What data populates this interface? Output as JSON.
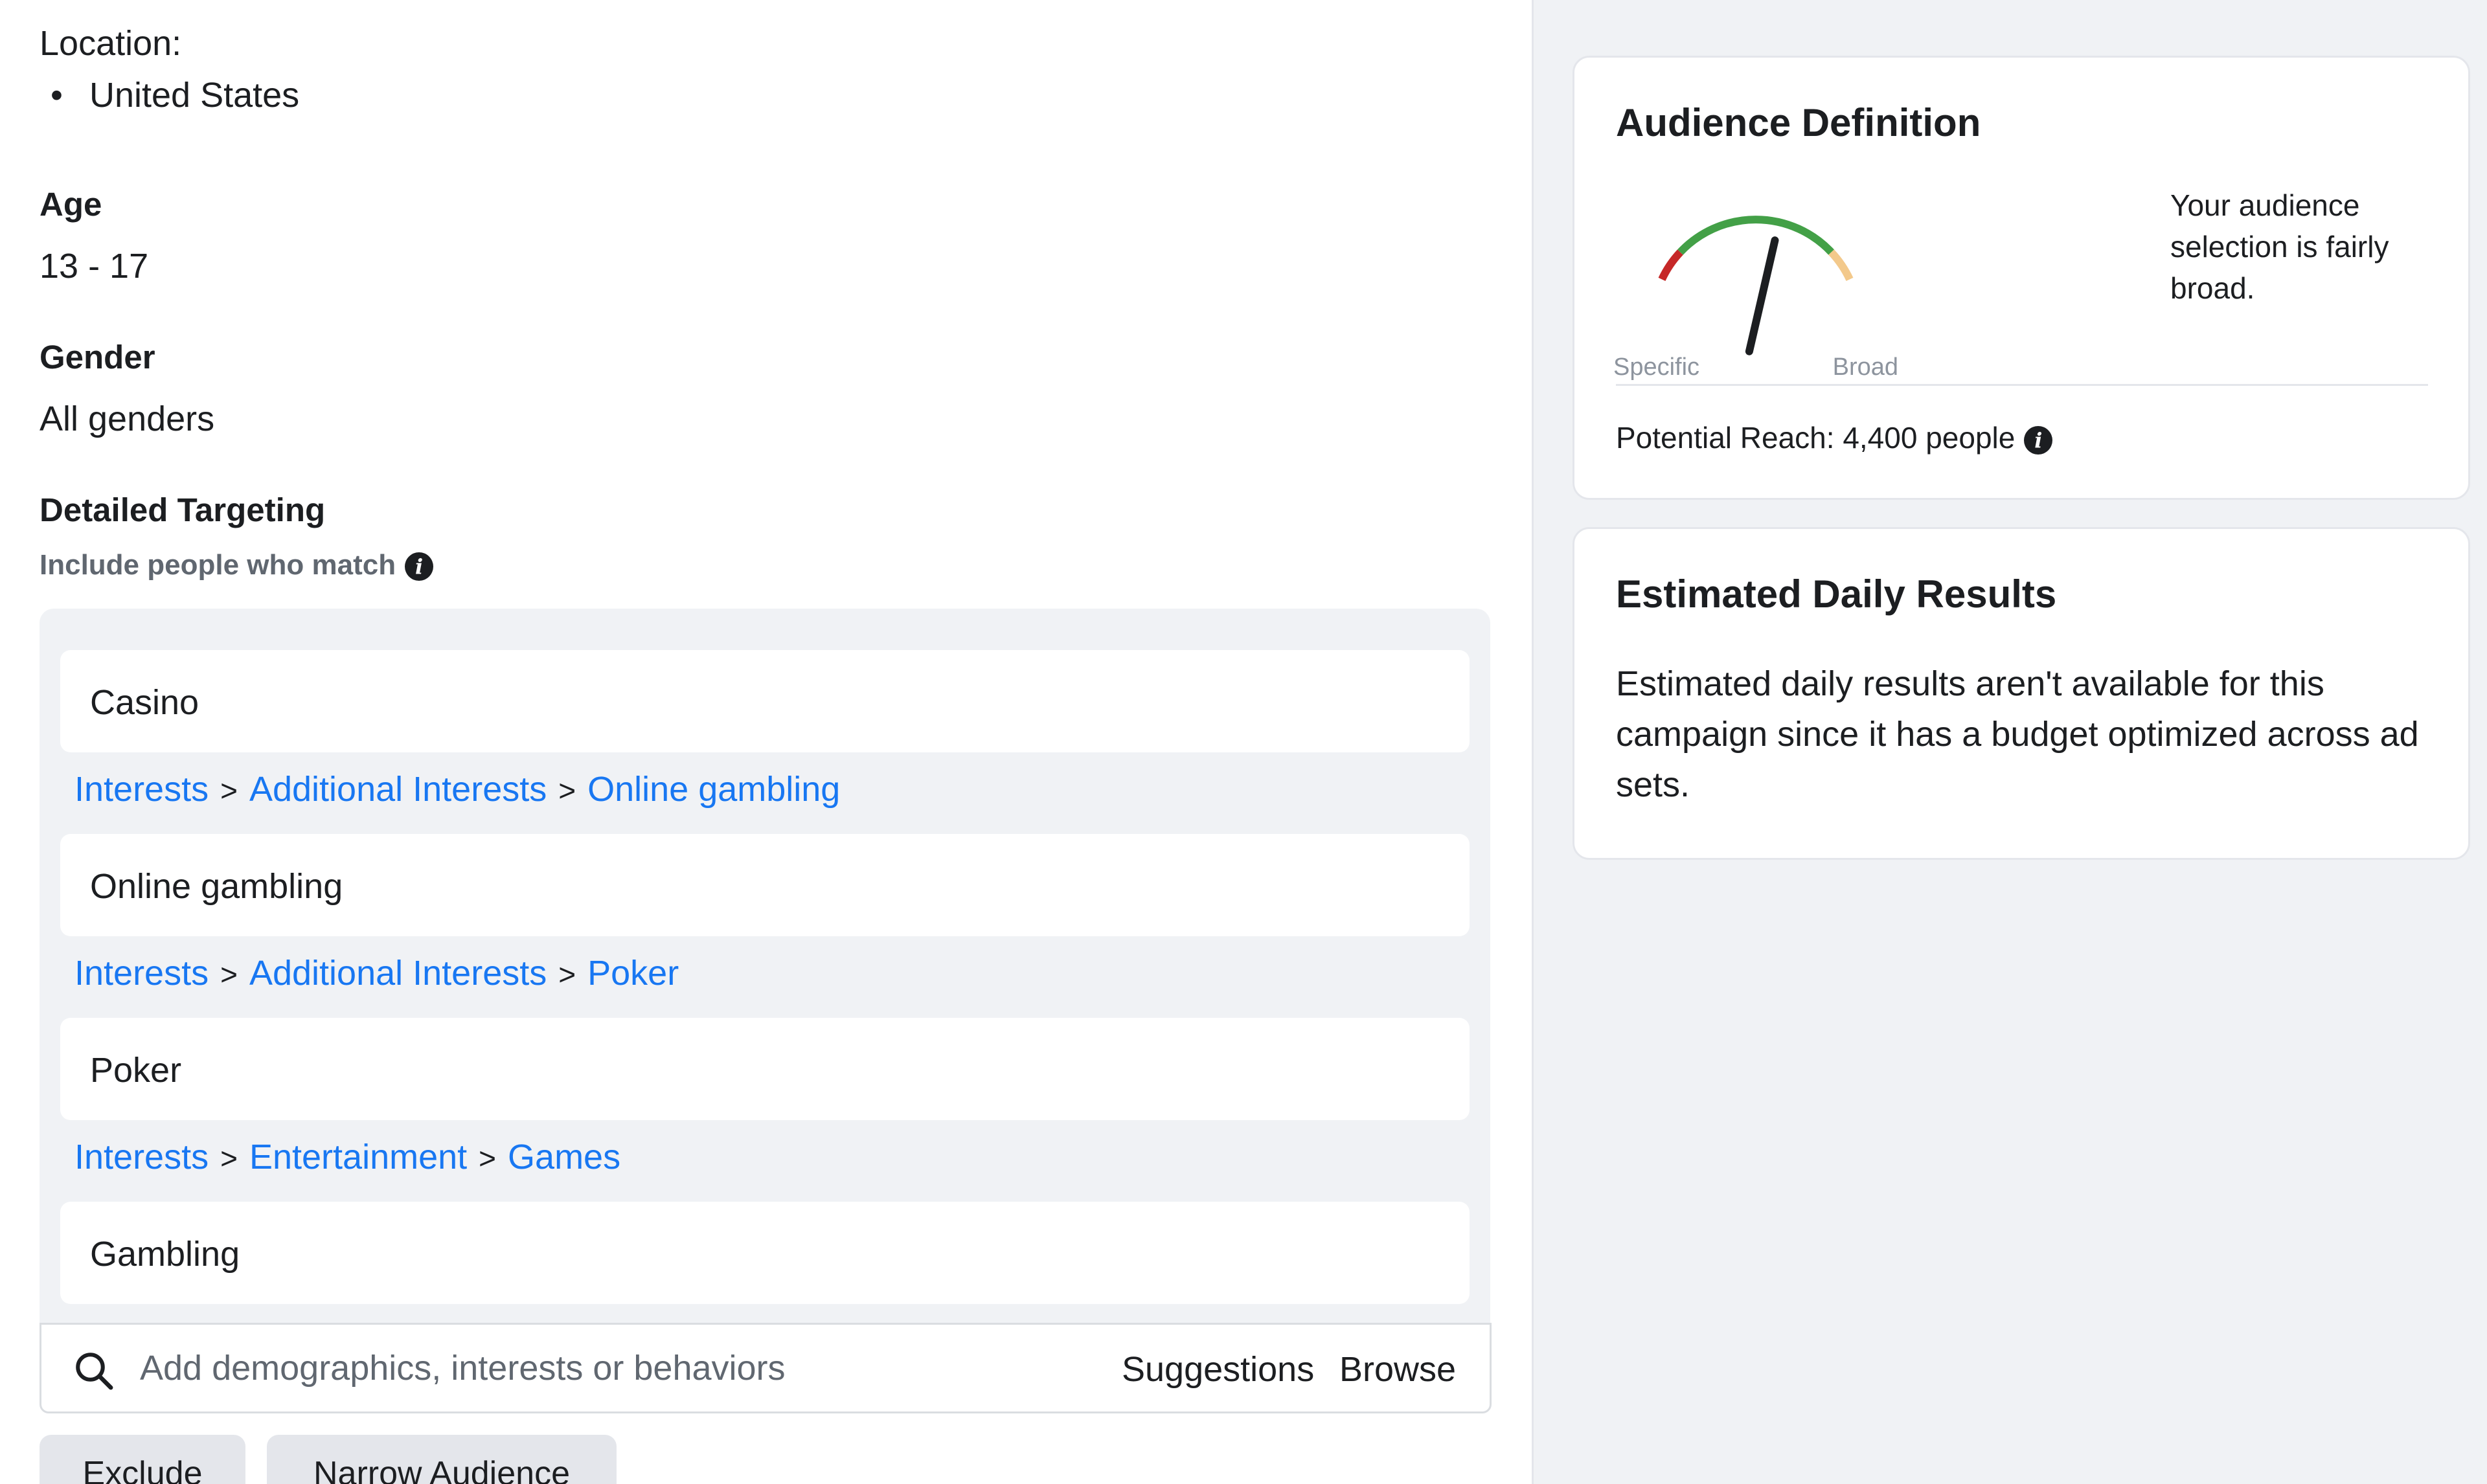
{
  "location": {
    "label": "Location:",
    "items": [
      "United States"
    ]
  },
  "age": {
    "label": "Age",
    "value": "13 - 17"
  },
  "gender": {
    "label": "Gender",
    "value": "All genders"
  },
  "detailed_targeting": {
    "label": "Detailed Targeting",
    "sublabel": "Include people who match",
    "items": [
      {
        "name": "Casino",
        "path": [
          "Interests",
          "Additional Interests",
          "Online gambling"
        ]
      },
      {
        "name": "Online gambling",
        "path": [
          "Interests",
          "Additional Interests",
          "Poker"
        ]
      },
      {
        "name": "Poker",
        "path": [
          "Interests",
          "Entertainment",
          "Games"
        ]
      },
      {
        "name": "Gambling"
      }
    ],
    "crumb_separator": ">",
    "search": {
      "placeholder": "Add demographics, interests or behaviors",
      "suggestions_label": "Suggestions",
      "browse_label": "Browse"
    },
    "exclude_label": "Exclude",
    "narrow_label": "Narrow Audience"
  },
  "audience_definition": {
    "title": "Audience Definition",
    "gauge": {
      "left_label": "Specific",
      "right_label": "Broad",
      "level": 0.6
    },
    "description": "Your audience selection is fairly broad.",
    "reach": "Potential Reach: 4,400 people"
  },
  "estimated_daily_results": {
    "title": "Estimated Daily Results",
    "text": "Estimated daily results aren't available for this campaign since it has a budget optimized across ad sets."
  },
  "colors": {
    "link": "#1877f2",
    "gauge_green": "#43a047",
    "gauge_red": "#c62828",
    "gauge_light": "#f3c98b",
    "panel_bg": "#f0f2f5"
  },
  "icons": {
    "info": "info-icon",
    "search": "search-icon"
  }
}
